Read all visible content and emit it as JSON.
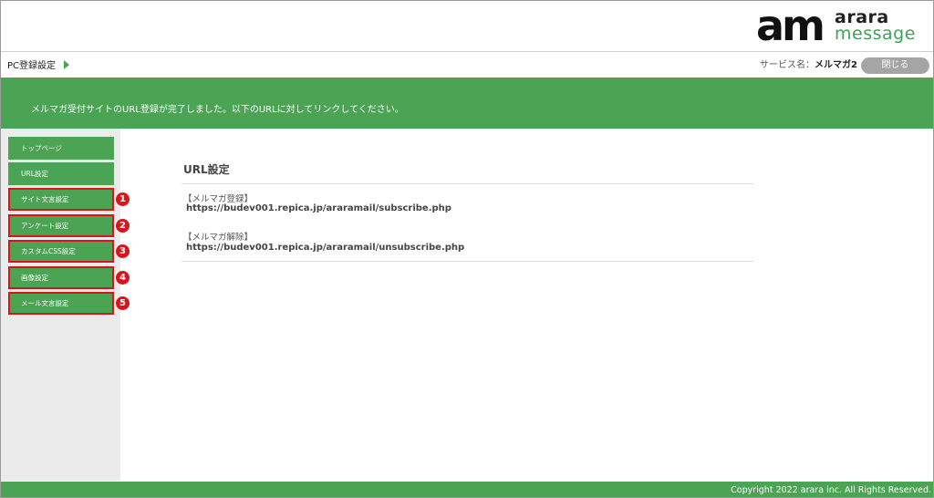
{
  "logo": {
    "mark": "am",
    "word1": "arara",
    "word2": "message"
  },
  "breadcrumb": {
    "label": "PC登録設定"
  },
  "service": {
    "prefix": "サービス名：",
    "name": "メルマガ2"
  },
  "close_label": "閉じる",
  "banner_message": "メルマガ受付サイトのURL登録が完了しました。以下のURLに対してリンクしてください。",
  "sidebar": {
    "items": [
      {
        "label": "トップページ"
      },
      {
        "label": "URL設定"
      },
      {
        "label": "サイト文言設定",
        "badge": "1"
      },
      {
        "label": "アンケート設定",
        "badge": "2"
      },
      {
        "label": "カスタムCSS設定",
        "badge": "3"
      },
      {
        "label": "画像設定",
        "badge": "4"
      },
      {
        "label": "メール文言設定",
        "badge": "5"
      }
    ]
  },
  "main": {
    "title": "URL設定",
    "subscribe_label": "【メルマガ登録】",
    "subscribe_url": "https://budev001.repica.jp/araramail/subscribe.php",
    "unsubscribe_label": "【メルマガ解除】",
    "unsubscribe_url": "https://budev001.repica.jp/araramail/unsubscribe.php"
  },
  "footer": {
    "copyright": "Copyright 2022 arara inc. All Rights Reserved."
  },
  "colors": {
    "brand_green": "#4aa454",
    "highlight_red": "#d9141b",
    "button_gray": "#a5a5a5",
    "sidebar_bg": "#ebebeb"
  }
}
